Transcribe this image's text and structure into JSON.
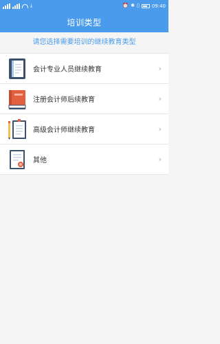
{
  "statusbar": {
    "time": "09:40"
  },
  "header": {
    "title": "培训类型"
  },
  "subtitle": "请您选择需要培训的继续教育类型",
  "items": [
    {
      "label": "会计专业人员继续教育",
      "icon": "notebook-icon"
    },
    {
      "label": "注册会计师后续教育",
      "icon": "book-icon"
    },
    {
      "label": "高级会计师继续教育",
      "icon": "notepad-pen-icon"
    },
    {
      "label": "其他",
      "icon": "certificate-icon"
    }
  ],
  "colors": {
    "primary": "#4a9bec",
    "text": "#333333",
    "chevron": "#aaaaaa",
    "background": "#f5f5f5"
  }
}
